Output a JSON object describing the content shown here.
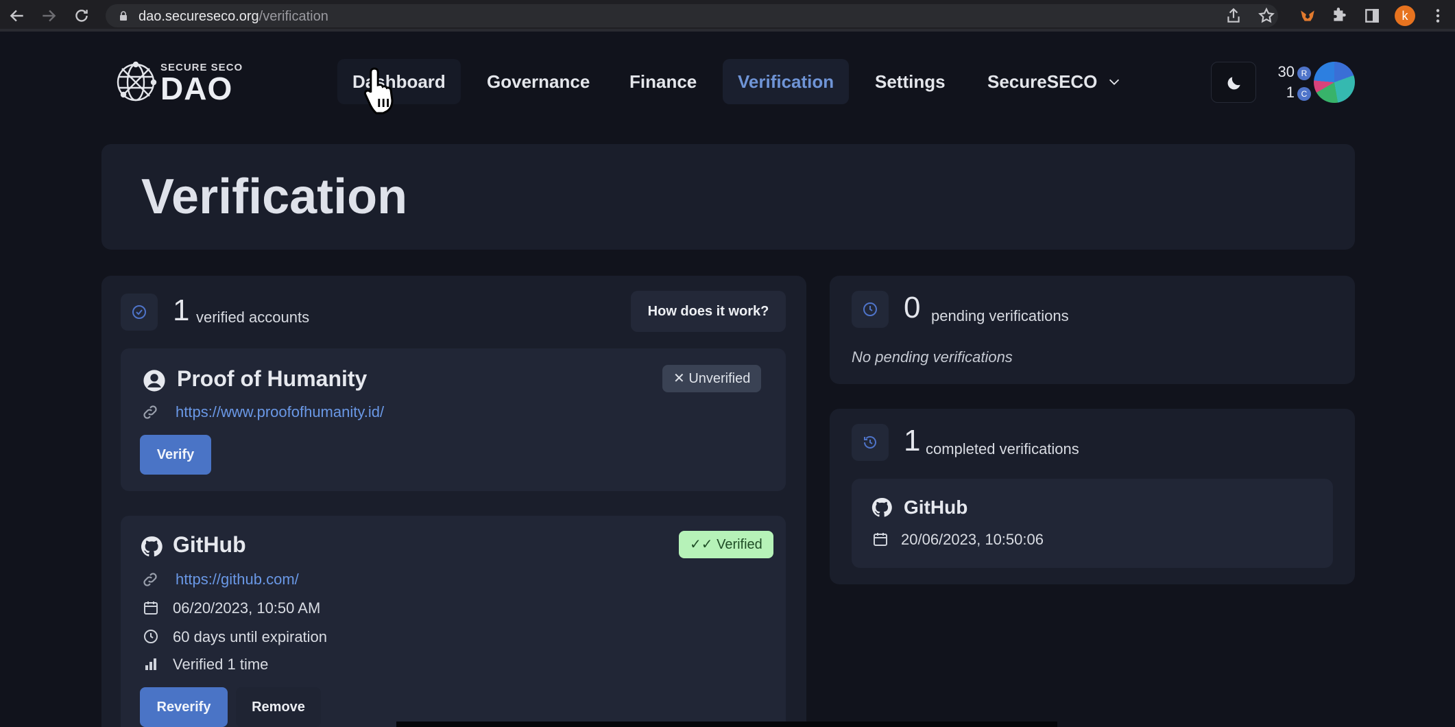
{
  "browser": {
    "url_domain": "dao.secureseco.org",
    "url_path": "/verification",
    "profile_initial": "k"
  },
  "logo": {
    "small_text": "SECURE SECO",
    "big_text": "DAO"
  },
  "nav": {
    "items": [
      {
        "label": "Dashboard"
      },
      {
        "label": "Governance"
      },
      {
        "label": "Finance"
      },
      {
        "label": "Verification"
      },
      {
        "label": "Settings"
      },
      {
        "label": "SecureSECO"
      }
    ],
    "active": "Verification"
  },
  "wallet": {
    "rep_balance": "30",
    "rep_symbol": "R",
    "coin_balance": "1",
    "coin_symbol": "C"
  },
  "page": {
    "title": "Verification"
  },
  "verified": {
    "count": "1",
    "label": "verified accounts",
    "how_button": "How does it work?",
    "accounts": [
      {
        "name": "Proof of Humanity",
        "status": "Unverified",
        "link": "https://www.proofofhumanity.id/",
        "action": "Verify"
      },
      {
        "name": "GitHub",
        "status": "Verified",
        "link": "https://github.com/",
        "date": "06/20/2023, 10:50 AM",
        "expiration": "60 days until expiration",
        "times": "Verified 1 time",
        "action": "Reverify",
        "secondary_action": "Remove"
      }
    ]
  },
  "pending": {
    "count": "0",
    "label": "pending verifications",
    "empty": "No pending verifications"
  },
  "completed": {
    "count": "1",
    "label": "completed verifications",
    "items": [
      {
        "name": "GitHub",
        "date": "20/06/2023, 10:50:06"
      }
    ]
  },
  "colors": {
    "background": "#11131c",
    "card": "#1a1e2b",
    "accent": "#4a74c6",
    "verified_badge": "#b6f2b8"
  }
}
